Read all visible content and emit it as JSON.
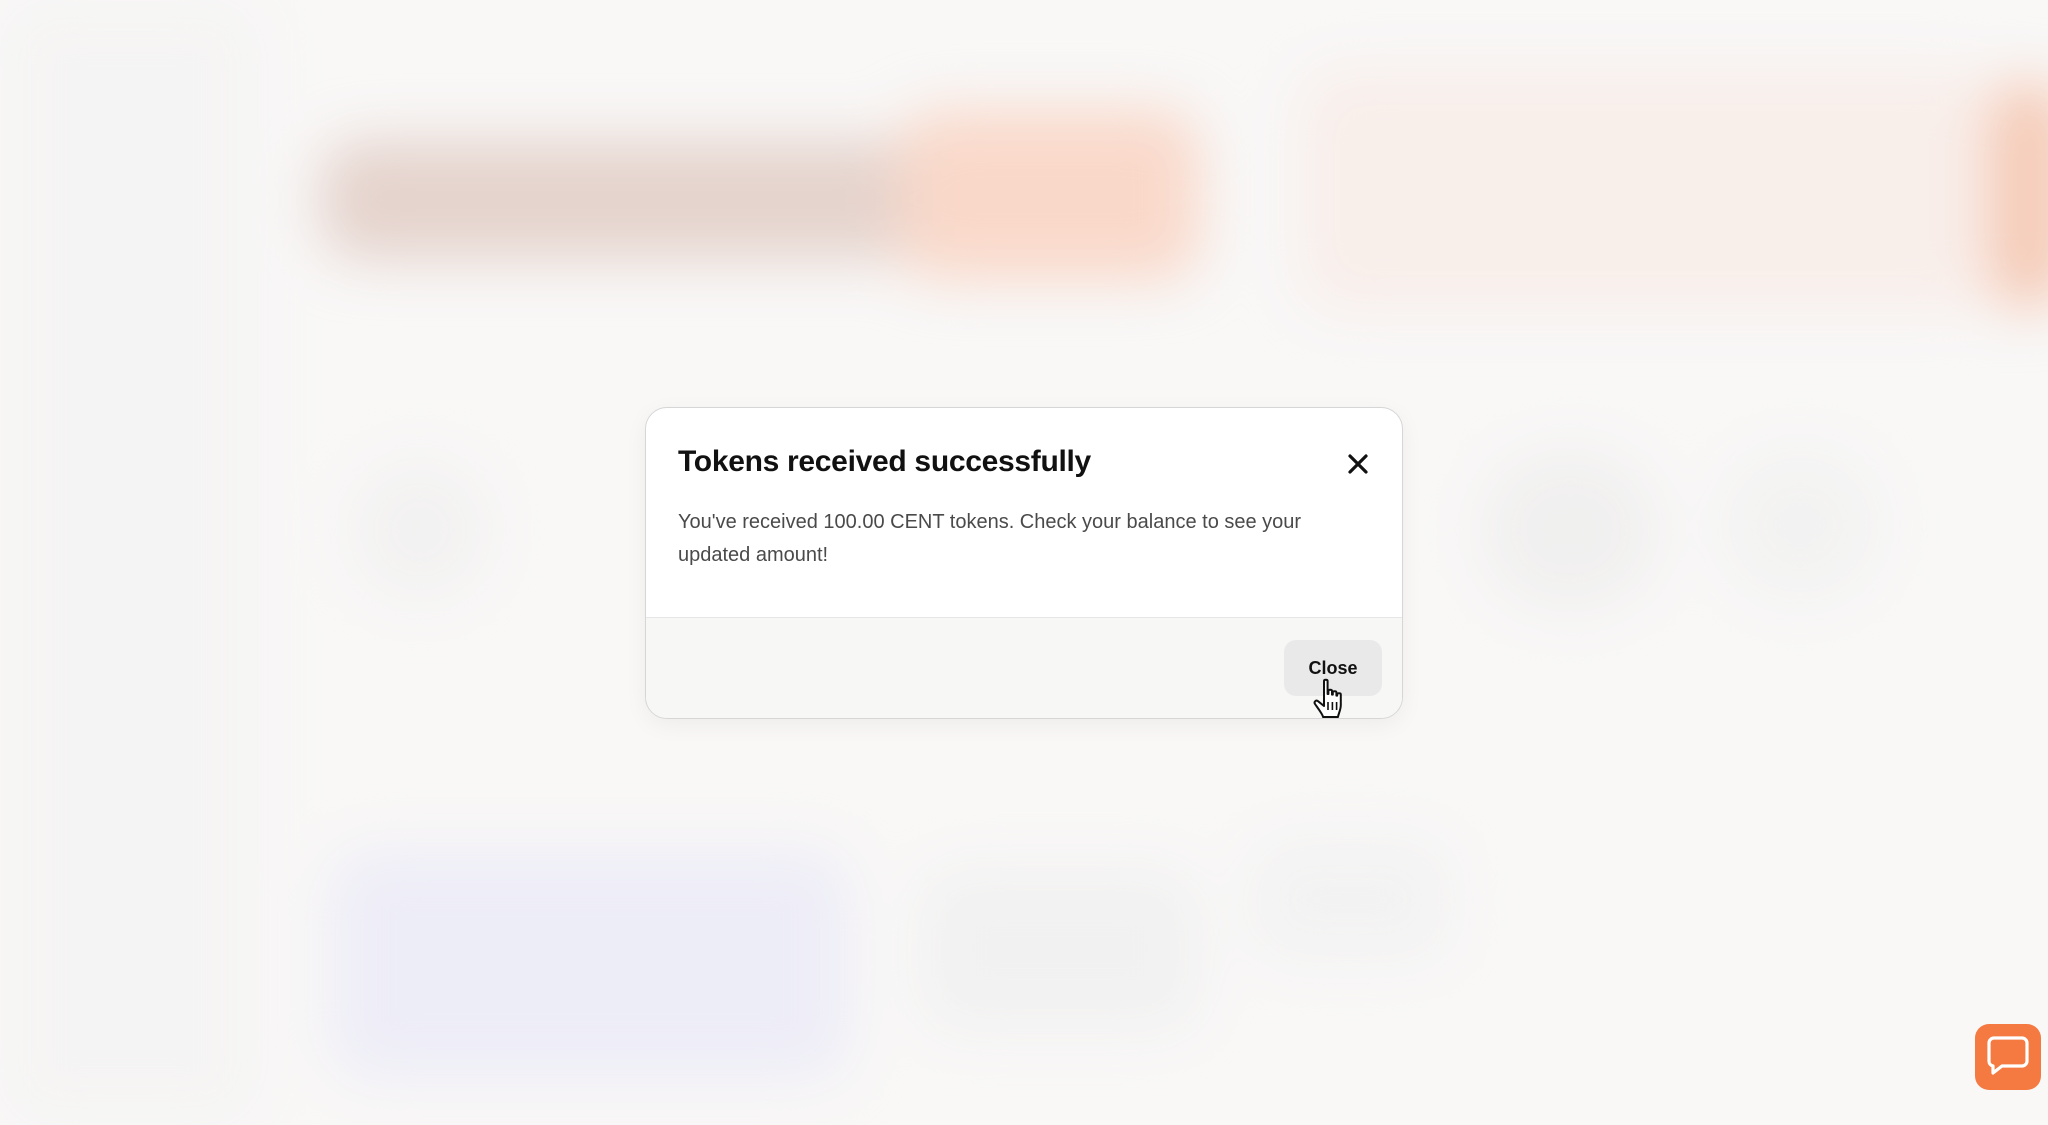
{
  "modal": {
    "title": "Tokens received successfully",
    "message": "You've received 100.00 CENT tokens. Check your balance to see your updated amount!",
    "close_button_label": "Close",
    "close_icon": "close-icon"
  },
  "chat": {
    "icon": "chat-bubble-icon",
    "accent": "#f57a41"
  },
  "colors": {
    "background": "#f6f4f3",
    "modal_background": "#ffffff",
    "footer_background": "#f7f7f5",
    "button_background": "#e9e9e9"
  }
}
